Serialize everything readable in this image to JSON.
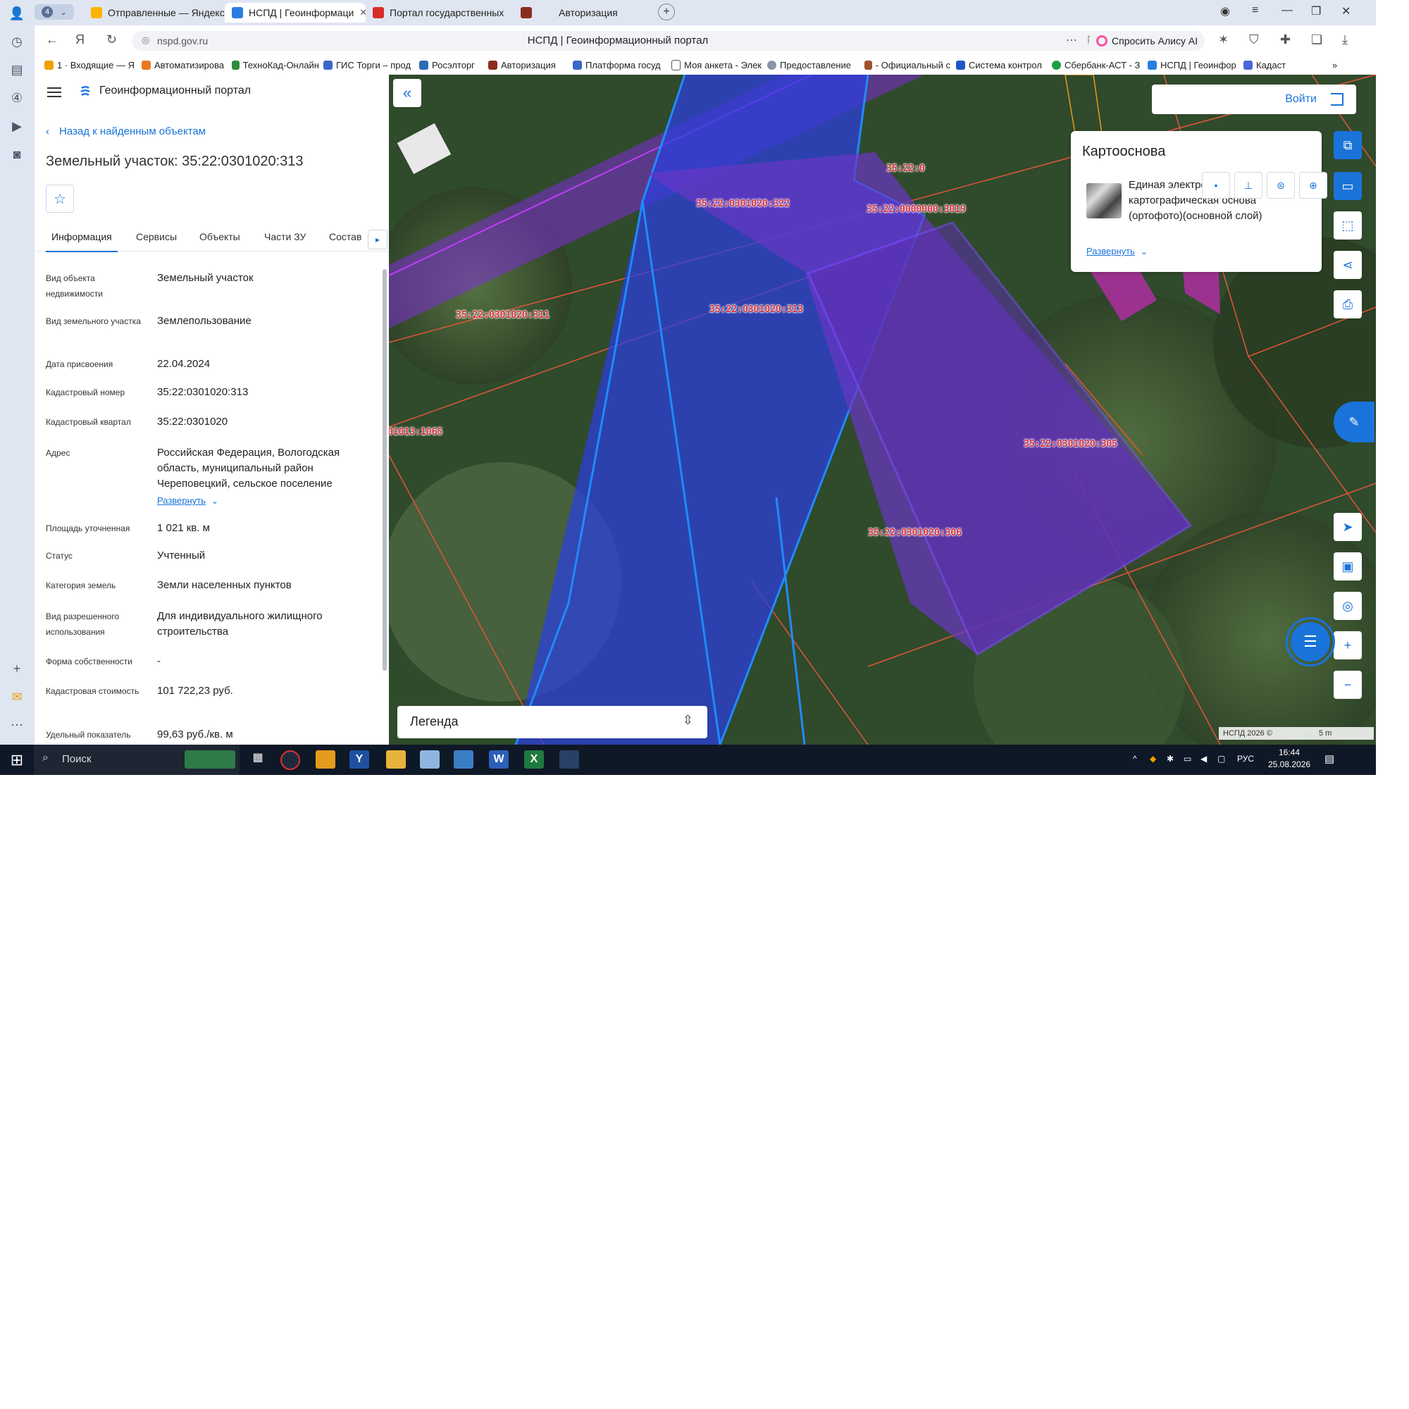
{
  "browser": {
    "tab_count": "4",
    "tabs": [
      {
        "label": "Отправленные — Яндекс",
        "color": "#ffb300"
      },
      {
        "label": "НСПД | Геоинформаци",
        "color": "#2a7de1"
      },
      {
        "label": "Портал государственных",
        "color": "#d62b2b"
      },
      {
        "label": "Авторизация",
        "color": "#8b2d1d"
      }
    ],
    "url": "nspd.gov.ru",
    "page_title": "НСПД | Геоинформационный портал",
    "alice_label": "Спросить Алису AI",
    "bookmarks": [
      "1 · Входящие — Я",
      "Автоматизирова",
      "ТехноКад-Онлайн",
      "ГИС Торги – прод",
      "Росэлторг",
      "Авторизация",
      "Платформа госуд",
      "Моя анкета - Элек",
      "Предоставление",
      "- Официальный с",
      "Система контрол",
      "Сбербанк-АСТ - З",
      "НСПД | Геоинфор",
      "Кадаст"
    ]
  },
  "panel": {
    "app_title": "Геоинформационный портал",
    "back_label": "Назад к найденным объектам",
    "heading": "Земельный участок: 35:22:0301020:313",
    "tabs": [
      "Информация",
      "Сервисы",
      "Объекты",
      "Части ЗУ",
      "Состав"
    ],
    "rows": [
      {
        "key": "Вид объекта недвижимости",
        "value": "Земельный участок"
      },
      {
        "key": "Вид земельного участка",
        "value": "Землепользование"
      },
      {
        "key": "Дата присвоения",
        "value": "22.04.2024"
      },
      {
        "key": "Кадастровый номер",
        "value": "35:22:0301020:313"
      },
      {
        "key": "Кадастровый квартал",
        "value": "35:22:0301020"
      },
      {
        "key": "Адрес",
        "value": "Российская Федерация, Вологодская область, муниципальный район Череповецкий, сельское поселение"
      },
      {
        "key": "Площадь уточненная",
        "value": "1 021 кв. м"
      },
      {
        "key": "Статус",
        "value": "Учтенный"
      },
      {
        "key": "Категория земель",
        "value": "Земли населенных пунктов"
      },
      {
        "key": "Вид разрешенного использования",
        "value": "Для индивидуального жилищного строительства"
      },
      {
        "key": "Форма собственности",
        "value": "-"
      },
      {
        "key": "Кадастровая стоимость",
        "value": "101 722,23 руб."
      },
      {
        "key": "Удельный показатель",
        "value": "99,63 руб./кв. м"
      }
    ],
    "address_expand": "Развернуть"
  },
  "map": {
    "login_label": "Войти",
    "basemap_title": "Картооснова",
    "basemap_desc": "Единая электронная картографическая основа (ортофото)(основной слой)",
    "basemap_expand": "Развернуть",
    "legend_label": "Легенда",
    "scale_label": "5 m",
    "copyright": "НСПД 2026 ©",
    "parcel_labels": [
      "35:22:0301020:311",
      "35:22:0301020:313",
      "35:22:0301020:322",
      "35:22:0000000:3019",
      "35:22:0301020:305",
      "35:22:0301020:306",
      "01013:1065",
      "35:22:0"
    ]
  },
  "taskbar": {
    "search_placeholder": "Поиск",
    "language": "РУС",
    "time": "16:44",
    "date": "25.08.2026"
  }
}
